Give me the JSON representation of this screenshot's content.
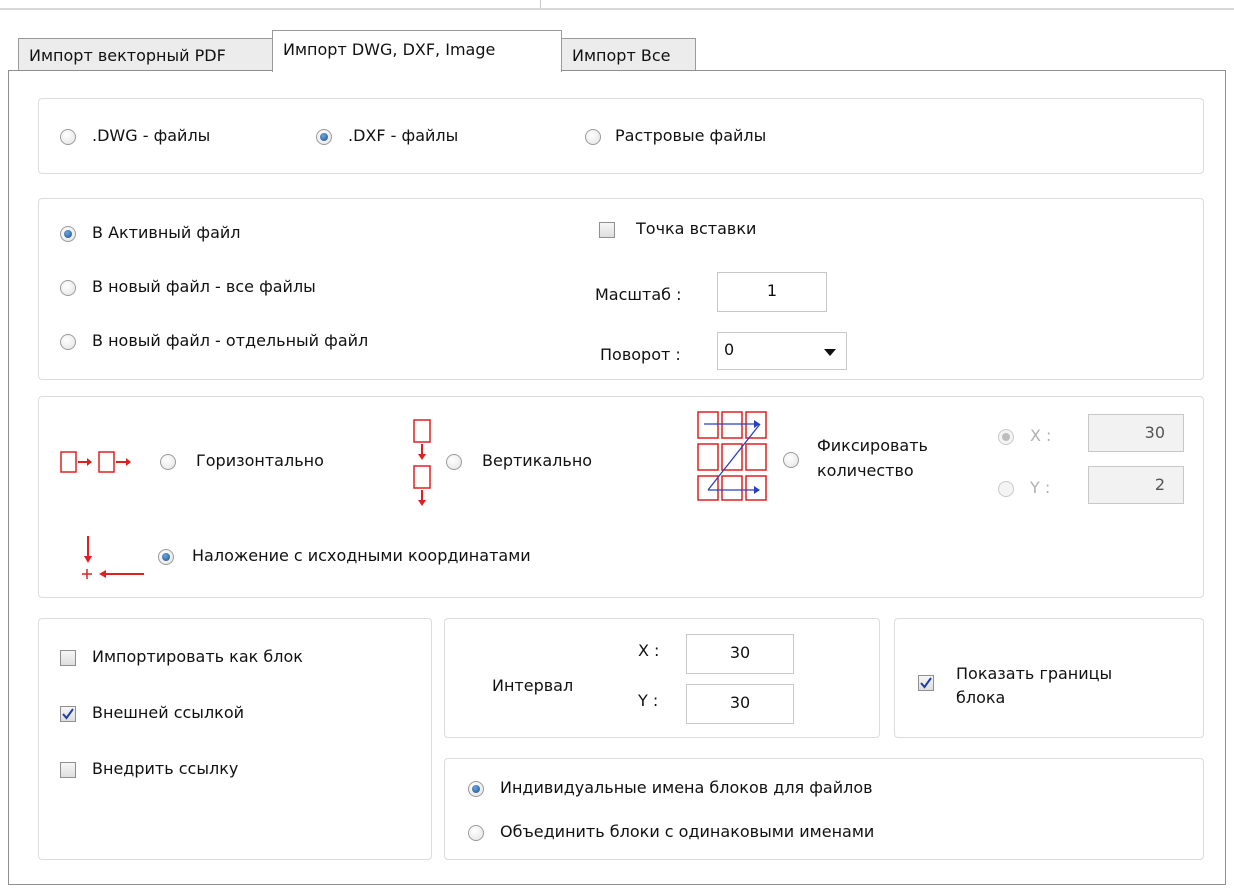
{
  "tabs": [
    {
      "label": "Импорт векторный PDF"
    },
    {
      "label": "Импорт DWG, DXF, Image"
    },
    {
      "label": "Импорт Все"
    }
  ],
  "file_type": {
    "options": [
      {
        "label": ".DWG - файлы",
        "selected": false
      },
      {
        "label": ".DXF - файлы",
        "selected": true
      },
      {
        "label": "Растровые файлы",
        "selected": false
      }
    ]
  },
  "target": {
    "options": [
      {
        "label": "В Активный файл",
        "selected": true
      },
      {
        "label": "В новый файл - все файлы",
        "selected": false
      },
      {
        "label": "В новый файл - отдельный файл",
        "selected": false
      }
    ],
    "insert_point_label": "Точка вставки",
    "insert_point_checked": false,
    "scale_label": "Масштаб :",
    "scale_value": "1",
    "rotation_label": "Поворот :",
    "rotation_value": "0"
  },
  "layout": {
    "horizontal_label": "Горизонтально",
    "vertical_label": "Вертикально",
    "fixed_label_line1": "Фиксировать",
    "fixed_label_line2": "количество",
    "x_label": "X :",
    "x_value": "30",
    "y_label": "Y :",
    "y_value": "2",
    "overlay_label": "Наложение с исходными координатами",
    "selected": "overlay"
  },
  "block": {
    "import_as_block_label": "Импортировать как блок",
    "import_as_block_checked": false,
    "external_ref_label": "Внешней ссылкой",
    "external_ref_checked": true,
    "embed_ref_label": "Внедрить ссылку",
    "embed_ref_checked": false
  },
  "interval": {
    "label": "Интервал",
    "x_label": "X :",
    "x_value": "30",
    "y_label": "Y :",
    "y_value": "30"
  },
  "show_bounds": {
    "label_line1": "Показать границы",
    "label_line2": "блока",
    "checked": true
  },
  "naming": {
    "options": [
      {
        "label": "Индивидуальные имена блоков для файлов",
        "selected": true
      },
      {
        "label": "Объединить блоки с одинаковыми именами",
        "selected": false
      }
    ]
  },
  "colors": {
    "icon_red": "#e02020",
    "icon_blue": "#2a3fc0",
    "radio_blue": "#1b4f8f"
  }
}
